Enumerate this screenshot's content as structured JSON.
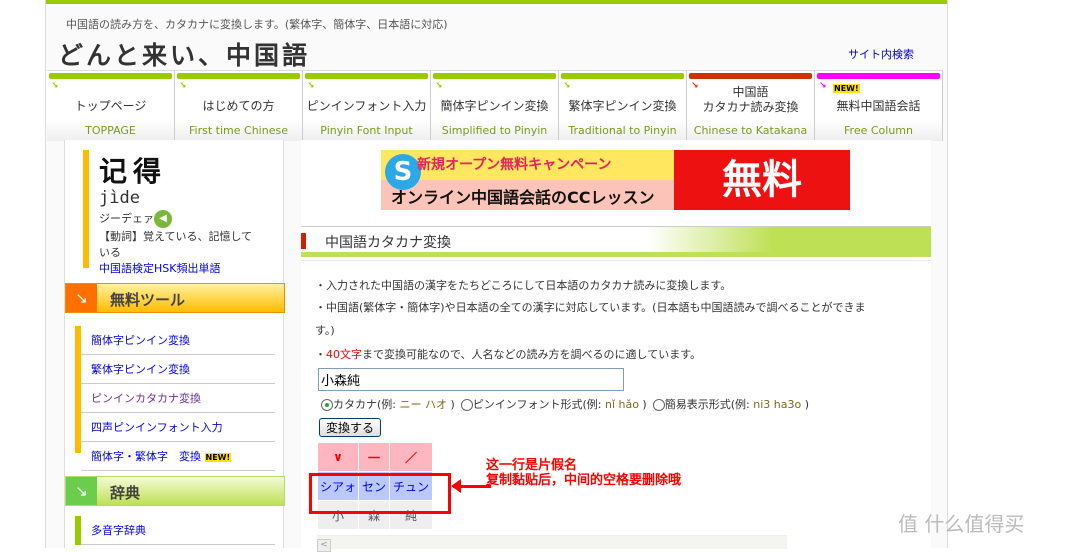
{
  "header": {
    "tagline": "中国語の読み方を、カタカナに変換します。(繁体字、簡体字、日本語に対応)",
    "logo": "どんと来い、中国語",
    "site_search": "サイト内検索"
  },
  "nav": [
    {
      "jp": "トップページ",
      "en": "TOPPAGE",
      "color": "#99cc00"
    },
    {
      "jp": "はじめての方",
      "en": "First time Chinese",
      "color": "#99cc00"
    },
    {
      "jp": "ピンインフォント入力",
      "en": "Pinyin Font Input",
      "color": "#99cc00"
    },
    {
      "jp": "簡体字ピンイン変換",
      "en": "Simplified to Pinyin",
      "color": "#99cc00"
    },
    {
      "jp": "繁体字ピンイン変換",
      "en": "Traditional to Pinyin",
      "color": "#99cc00"
    },
    {
      "jp": "中国語\nカタカナ読み変換",
      "en": "Chinese to Katakana",
      "color": "#cc3300",
      "active": true
    },
    {
      "jp": "無料中国語会話",
      "en": "Free Column",
      "color": "#ff00ff",
      "badge": "NEW!"
    }
  ],
  "word": {
    "hanzi": "记得",
    "pinyin": "jìde",
    "katakana": "ジーデェァ",
    "meaning": "【動詞】覚えている、記憶している",
    "link": "中国語検定HSK頻出単語",
    "icon": "speaker-icon"
  },
  "sidebar": {
    "tools_title": "無料ツール",
    "tools": [
      {
        "label": "簡体字ピンイン変換"
      },
      {
        "label": "繁体字ピンイン変換"
      },
      {
        "label": "ピンインカタカナ変換",
        "visited": true
      },
      {
        "label": "四声ピンインフォント入力"
      },
      {
        "label": "簡体字・繁体字　変換",
        "badge": "NEW!"
      }
    ],
    "dict_title": "辞典",
    "dict": [
      {
        "label": "多音字辞典"
      }
    ]
  },
  "banner": {
    "line1": "新規オープン無料キャンペーン",
    "line2": "オンライン中国語会話のCCレッスン",
    "big": "無料",
    "icon": "skype-icon"
  },
  "page_title": "中国語カタカナ変換",
  "desc": {
    "p1": "・入力された中国語の漢字をたちどころにして日本語のカタカナ読みに変換します。",
    "p2": "・中国語(繁体字・簡体字)や日本語の全ての漢字に対応しています。(日本語も中国語読みで調べることができま",
    "p2b": "す。)",
    "p3_pre": "・",
    "p3_red": "40文字",
    "p3_post": "まで変換可能なので、人名などの読み方を調べるのに適しています。"
  },
  "form": {
    "input_value": "小森純",
    "options": [
      {
        "label": "カタカナ(例: ",
        "example": "ニー ハオ",
        "close": " )",
        "selected": true
      },
      {
        "label": "ピンインフォント形式(例: ",
        "example": "nǐ hǎo",
        "close": " )",
        "selected": false
      },
      {
        "label": "簡易表示形式(例: ",
        "example": "ni3 ha3o",
        "close": " )",
        "selected": false
      }
    ],
    "button": "変換する"
  },
  "result": {
    "tones": [
      "∨",
      "一",
      "／"
    ],
    "katakana": [
      "シアォ",
      "セン",
      "チュン"
    ],
    "hanzi": [
      "小",
      "森",
      "純"
    ]
  },
  "annotation": "这一行是片假名\n复制黏贴后，中间的空格要删除哦",
  "watermark": "值 什么值得买"
}
